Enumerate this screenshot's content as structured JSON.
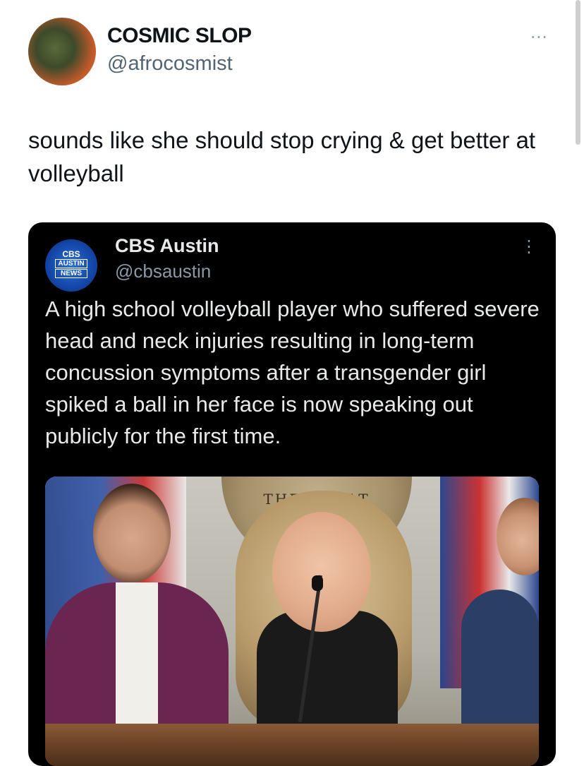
{
  "author": {
    "display_name": "COSMIC SLOP",
    "handle": "@afrocosmist",
    "avatar_icon": "profile-avatar",
    "more_label": "..."
  },
  "tweet": {
    "text": "sounds like she should stop crying & get better at volleyball"
  },
  "quoted_tweet": {
    "display_name": "CBS Austin",
    "handle": "@cbsaustin",
    "avatar_logo": {
      "line1": "CBS",
      "line2": "AUSTIN",
      "line3": "NEWS"
    },
    "more_label": "⋮",
    "text": "A high school volleyball player who suffered severe head and neck injuries resulting in long-term concussion symptoms after a transgender girl spiked a ball in her face is now speaking out publicly for the first time.",
    "media": {
      "seal_text": "THE GREAT    CAROLINA"
    }
  },
  "colors": {
    "text_primary": "#0f1419",
    "text_secondary": "#536471",
    "quote_background": "#000000",
    "quote_text": "#e7e9ea"
  }
}
